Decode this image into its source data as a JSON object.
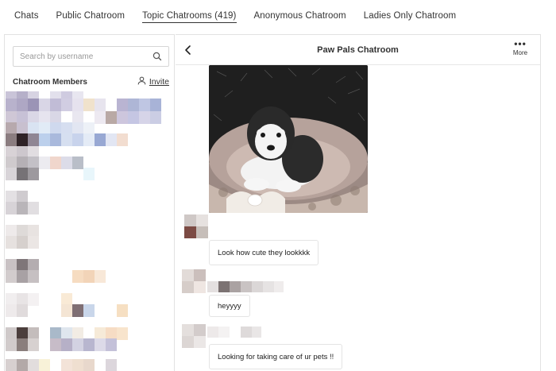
{
  "nav": {
    "tabs": [
      {
        "label": "Chats"
      },
      {
        "label": "Public Chatroom"
      },
      {
        "label": "Topic Chatrooms (419)"
      },
      {
        "label": "Anonymous Chatroom"
      },
      {
        "label": "Ladies Only Chatroom"
      }
    ],
    "active_index": 2
  },
  "sidebar": {
    "search_placeholder": "Search by username",
    "members_title": "Chatroom Members",
    "invite_label": "Invite"
  },
  "chat": {
    "title": "Paw Pals Chatroom",
    "more_label": "More",
    "messages": [
      {
        "text": "Look how cute they lookkkk"
      },
      {
        "text": "heyyyy"
      },
      {
        "text": "Looking for taking care of ur pets !!"
      }
    ]
  },
  "icons": {
    "search": "search-icon",
    "invite": "person-icon",
    "back": "chevron-left-icon",
    "more": "more-dots-icon"
  },
  "colors": {
    "text": "#222222",
    "border": "#e2e2e2",
    "active_underline": "#333333"
  }
}
